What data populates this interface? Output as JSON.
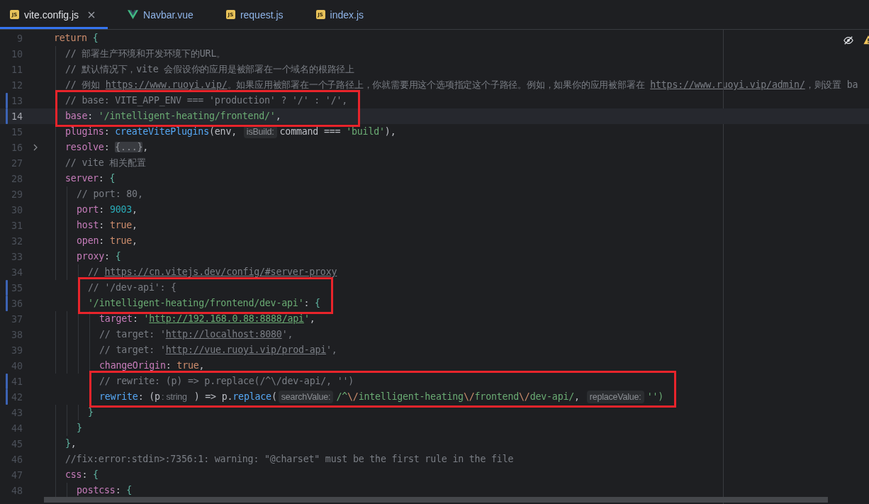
{
  "tabs": [
    {
      "label": "vite.config.js",
      "kind": "js",
      "badge": "JS",
      "selected": true
    },
    {
      "label": "Navbar.vue",
      "kind": "vue",
      "selected": false
    },
    {
      "label": "request.js",
      "kind": "js",
      "badge": "JS",
      "selected": false
    },
    {
      "label": "index.js",
      "kind": "js",
      "badge": "JS",
      "selected": false
    }
  ],
  "code": {
    "lines": [
      {
        "number": "9",
        "changed": false,
        "current": false,
        "folded": false,
        "highlighted": false,
        "tokens": [
          {
            "kind": "kw",
            "text": "return "
          },
          {
            "kind": "brace",
            "text": "{"
          }
        ],
        "children": [
          {
            "number": "10",
            "changed": false,
            "current": false,
            "folded": false,
            "highlighted": false,
            "tokens": [
              {
                "kind": "comment",
                "text": "// 部署生产环境和开发环境下的URL。"
              }
            ]
          },
          {
            "number": "11",
            "changed": false,
            "current": false,
            "folded": false,
            "highlighted": false,
            "tokens": [
              {
                "kind": "comment",
                "text": "// 默认情况下，vite 会假设你的应用是被部署在一个域名的根路径上"
              }
            ]
          },
          {
            "number": "12",
            "changed": false,
            "current": false,
            "folded": false,
            "highlighted": false,
            "tokens": [
              {
                "kind": "comment",
                "text": "// 例如 "
              },
              {
                "kind": "link",
                "text": "https://www.ruoyi.vip/"
              },
              {
                "kind": "comment",
                "text": "。如果应用被部署在一个子路径上，你就需要用这个选项指定这个子路径。例如，如果你的应用被部署在 "
              },
              {
                "kind": "link",
                "text": "https://www.ruoyi.vip/admin/"
              },
              {
                "kind": "comment",
                "text": "，则设置 ba"
              }
            ]
          },
          {
            "number": "13",
            "changed": true,
            "current": false,
            "folded": false,
            "highlighted": true,
            "tokens": [
              {
                "kind": "comment",
                "text": "// base: VITE_APP_ENV === 'production' ? '/' : '/',"
              }
            ]
          },
          {
            "number": "14",
            "changed": true,
            "current": true,
            "folded": false,
            "highlighted": true,
            "tokens": [
              {
                "kind": "prop",
                "text": "base"
              },
              {
                "kind": "plain",
                "text": ": "
              },
              {
                "kind": "str",
                "text": "'/intelligent-heating/frontend/'"
              },
              {
                "kind": "plain",
                "text": ","
              }
            ]
          },
          {
            "number": "15",
            "changed": false,
            "current": false,
            "folded": false,
            "highlighted": false,
            "tokens": [
              {
                "kind": "prop",
                "text": "plugins"
              },
              {
                "kind": "plain",
                "text": ": "
              },
              {
                "kind": "fn",
                "text": "createVitePlugins"
              },
              {
                "kind": "plain",
                "text": "(env, "
              },
              {
                "kind": "hint",
                "text": "isBuild:"
              },
              {
                "kind": "plain",
                "text": "command === "
              },
              {
                "kind": "str",
                "text": "'build'"
              },
              {
                "kind": "plain",
                "text": "),"
              }
            ]
          },
          {
            "number": "16",
            "changed": false,
            "current": false,
            "folded": true,
            "highlighted": false,
            "tokens": [
              {
                "kind": "prop",
                "text": "resolve"
              },
              {
                "kind": "plain",
                "text": ": "
              },
              {
                "kind": "fold",
                "text": "{...}"
              },
              {
                "kind": "plain",
                "text": ","
              }
            ]
          },
          {
            "number": "27",
            "changed": false,
            "current": false,
            "folded": false,
            "highlighted": false,
            "tokens": [
              {
                "kind": "comment",
                "text": "// vite 相关配置"
              }
            ]
          },
          {
            "number": "28",
            "changed": false,
            "current": false,
            "folded": false,
            "highlighted": false,
            "tokens": [
              {
                "kind": "prop",
                "text": "server"
              },
              {
                "kind": "plain",
                "text": ": "
              },
              {
                "kind": "brace",
                "text": "{"
              }
            ],
            "children": [
              {
                "number": "29",
                "changed": false,
                "current": false,
                "folded": false,
                "highlighted": false,
                "tokens": [
                  {
                    "kind": "comment",
                    "text": "// port: 80,"
                  }
                ]
              },
              {
                "number": "30",
                "changed": false,
                "current": false,
                "folded": false,
                "highlighted": false,
                "tokens": [
                  {
                    "kind": "prop",
                    "text": "port"
                  },
                  {
                    "kind": "plain",
                    "text": ": "
                  },
                  {
                    "kind": "num",
                    "text": "9003"
                  },
                  {
                    "kind": "plain",
                    "text": ","
                  }
                ]
              },
              {
                "number": "31",
                "changed": false,
                "current": false,
                "folded": false,
                "highlighted": false,
                "tokens": [
                  {
                    "kind": "prop",
                    "text": "host"
                  },
                  {
                    "kind": "plain",
                    "text": ": "
                  },
                  {
                    "kind": "kw",
                    "text": "true"
                  },
                  {
                    "kind": "plain",
                    "text": ","
                  }
                ]
              },
              {
                "number": "32",
                "changed": false,
                "current": false,
                "folded": false,
                "highlighted": false,
                "tokens": [
                  {
                    "kind": "prop",
                    "text": "open"
                  },
                  {
                    "kind": "plain",
                    "text": ": "
                  },
                  {
                    "kind": "kw",
                    "text": "true"
                  },
                  {
                    "kind": "plain",
                    "text": ","
                  }
                ]
              },
              {
                "number": "33",
                "changed": false,
                "current": false,
                "folded": false,
                "highlighted": false,
                "tokens": [
                  {
                    "kind": "prop",
                    "text": "proxy"
                  },
                  {
                    "kind": "plain",
                    "text": ": "
                  },
                  {
                    "kind": "brace",
                    "text": "{"
                  }
                ],
                "children": [
                  {
                    "number": "34",
                    "changed": false,
                    "current": false,
                    "folded": false,
                    "highlighted": false,
                    "tokens": [
                      {
                        "kind": "comment",
                        "text": "// "
                      },
                      {
                        "kind": "link",
                        "text": "https://cn.vitejs.dev/config/#server-proxy"
                      }
                    ]
                  },
                  {
                    "number": "35",
                    "changed": true,
                    "current": false,
                    "folded": false,
                    "highlighted": true,
                    "tokens": [
                      {
                        "kind": "comment",
                        "text": "// '/dev-api': {"
                      }
                    ]
                  },
                  {
                    "number": "36",
                    "changed": true,
                    "current": false,
                    "folded": false,
                    "highlighted": true,
                    "tokens": [
                      {
                        "kind": "str",
                        "text": "'/intelligent-heating/frontend/dev-api'"
                      },
                      {
                        "kind": "plain",
                        "text": ": "
                      },
                      {
                        "kind": "brace",
                        "text": "{"
                      }
                    ],
                    "children": [
                      {
                        "number": "37",
                        "changed": false,
                        "current": false,
                        "folded": false,
                        "highlighted": false,
                        "tokens": [
                          {
                            "kind": "prop",
                            "text": "target"
                          },
                          {
                            "kind": "plain",
                            "text": ": "
                          },
                          {
                            "kind": "str",
                            "text": "'"
                          },
                          {
                            "kind": "strlink",
                            "text": "http://192.168.0.88:8888/api"
                          },
                          {
                            "kind": "str",
                            "text": "'"
                          },
                          {
                            "kind": "plain",
                            "text": ","
                          }
                        ]
                      },
                      {
                        "number": "38",
                        "changed": false,
                        "current": false,
                        "folded": false,
                        "highlighted": false,
                        "tokens": [
                          {
                            "kind": "comment",
                            "text": "// target: '"
                          },
                          {
                            "kind": "link",
                            "text": "http://localhost:8080"
                          },
                          {
                            "kind": "comment",
                            "text": "',"
                          }
                        ]
                      },
                      {
                        "number": "39",
                        "changed": false,
                        "current": false,
                        "folded": false,
                        "highlighted": false,
                        "tokens": [
                          {
                            "kind": "comment",
                            "text": "// target: '"
                          },
                          {
                            "kind": "link",
                            "text": "http://vue.ruoyi.vip/prod-api"
                          },
                          {
                            "kind": "comment",
                            "text": "',"
                          }
                        ]
                      },
                      {
                        "number": "40",
                        "changed": false,
                        "current": false,
                        "folded": false,
                        "highlighted": false,
                        "tokens": [
                          {
                            "kind": "prop",
                            "text": "changeOrigin"
                          },
                          {
                            "kind": "plain",
                            "text": ": "
                          },
                          {
                            "kind": "kw",
                            "text": "true"
                          },
                          {
                            "kind": "plain",
                            "text": ","
                          }
                        ]
                      },
                      {
                        "number": "41",
                        "changed": true,
                        "current": false,
                        "folded": false,
                        "highlighted": true,
                        "tokens": [
                          {
                            "kind": "comment",
                            "text": "// rewrite: (p) => p.replace(/^\\/dev-api/, '')"
                          }
                        ]
                      },
                      {
                        "number": "42",
                        "changed": true,
                        "current": false,
                        "folded": false,
                        "highlighted": true,
                        "tokens": [
                          {
                            "kind": "fn",
                            "text": "rewrite"
                          },
                          {
                            "kind": "plain",
                            "text": ": (p"
                          },
                          {
                            "kind": "type",
                            "text": ": string"
                          },
                          {
                            "kind": "plain",
                            "text": " ) => p."
                          },
                          {
                            "kind": "fn",
                            "text": "replace"
                          },
                          {
                            "kind": "plain",
                            "text": "("
                          },
                          {
                            "kind": "hint",
                            "text": "searchValue:"
                          },
                          {
                            "kind": "regex",
                            "text": "/^"
                          },
                          {
                            "kind": "esc",
                            "text": "\\/"
                          },
                          {
                            "kind": "regex",
                            "text": "intelligent-heating"
                          },
                          {
                            "kind": "esc",
                            "text": "\\/"
                          },
                          {
                            "kind": "regex",
                            "text": "frontend"
                          },
                          {
                            "kind": "esc",
                            "text": "\\/"
                          },
                          {
                            "kind": "regex",
                            "text": "dev-api/"
                          },
                          {
                            "kind": "plain",
                            "text": ", "
                          },
                          {
                            "kind": "hint",
                            "text": "replaceValue:"
                          },
                          {
                            "kind": "str",
                            "text": "'')"
                          }
                        ]
                      }
                    ]
                  },
                  {
                    "number": "43",
                    "changed": false,
                    "current": false,
                    "folded": false,
                    "highlighted": false,
                    "tokens": [
                      {
                        "kind": "brace",
                        "text": "}"
                      }
                    ]
                  }
                ]
              },
              {
                "number": "44",
                "changed": false,
                "current": false,
                "folded": false,
                "highlighted": false,
                "tokens": [
                  {
                    "kind": "brace",
                    "text": "}"
                  }
                ]
              }
            ]
          },
          {
            "number": "45",
            "changed": false,
            "current": false,
            "folded": false,
            "highlighted": false,
            "tokens": [
              {
                "kind": "brace",
                "text": "}"
              },
              {
                "kind": "plain",
                "text": ","
              }
            ]
          },
          {
            "number": "46",
            "changed": false,
            "current": false,
            "folded": false,
            "highlighted": false,
            "tokens": [
              {
                "kind": "comment",
                "text": "//fix:error:stdin>:7356:1: warning: \"@charset\" must be the first rule in the file"
              }
            ]
          },
          {
            "number": "47",
            "changed": false,
            "current": false,
            "folded": false,
            "highlighted": false,
            "tokens": [
              {
                "kind": "prop",
                "text": "css"
              },
              {
                "kind": "plain",
                "text": ": "
              },
              {
                "kind": "brace",
                "text": "{"
              }
            ],
            "children": [
              {
                "number": "48",
                "changed": false,
                "current": false,
                "folded": false,
                "highlighted": false,
                "tokens": [
                  {
                    "kind": "prop",
                    "text": "postcss"
                  },
                  {
                    "kind": "plain",
                    "text": ": "
                  },
                  {
                    "kind": "brace",
                    "text": "{"
                  }
                ]
              }
            ]
          }
        ]
      }
    ]
  }
}
